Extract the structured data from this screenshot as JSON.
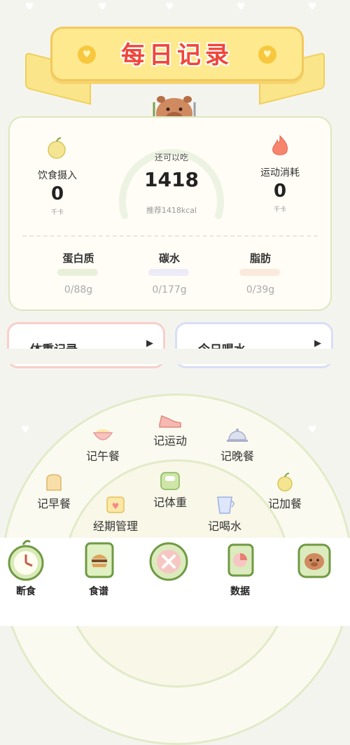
{
  "header": {
    "title": "每日记录"
  },
  "summary": {
    "intake": {
      "label": "饮食摄入",
      "value": "0",
      "unit": "千卡"
    },
    "remaining": {
      "title": "还可以吃",
      "value": "1418",
      "recommend": "推荐1418kcal"
    },
    "burn": {
      "label": "运动消耗",
      "value": "0",
      "unit": "千卡"
    }
  },
  "nutrients": [
    {
      "label": "蛋白质",
      "value": "0/88g",
      "color": "#e9f0d9"
    },
    {
      "label": "碳水",
      "value": "0/177g",
      "color": "#ecebf8"
    },
    {
      "label": "脂肪",
      "value": "0/39g",
      "color": "#fbeadc"
    }
  ],
  "cards": {
    "weight": {
      "label": "体重记录"
    },
    "water": {
      "label": "今日喝水"
    }
  },
  "fan_menu": {
    "exercise": "记运动",
    "lunch": "记午餐",
    "dinner": "记晚餐",
    "breakfast": "记早餐",
    "weight": "记体重",
    "snack": "记加餐",
    "period": "经期管理",
    "water": "记喝水"
  },
  "bottom_nav": {
    "fasting": "断食",
    "recipes": "食谱",
    "data": "数据"
  }
}
